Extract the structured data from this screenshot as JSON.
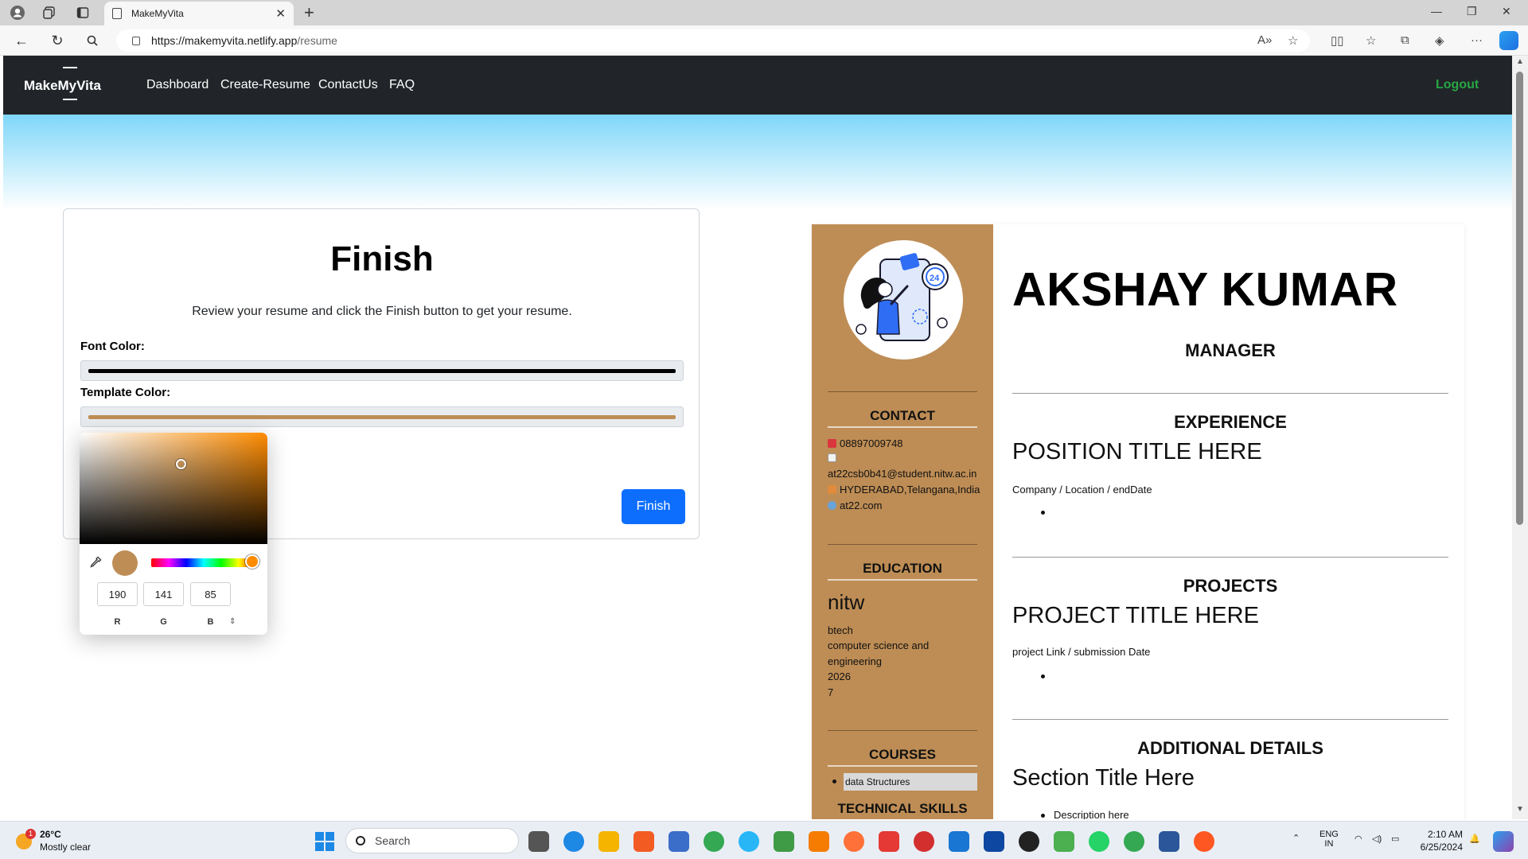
{
  "browser": {
    "tab_title": "MakeMyVita",
    "url_host": "https://makemyvita.netlify.app",
    "url_path": "/resume",
    "new_tab_icon": "plus-icon",
    "close_tab_icon": "close-icon"
  },
  "navbar": {
    "brand": "MakeMyVita",
    "links": [
      "Dashboard",
      "Create-Resume",
      "ContactUs",
      "FAQ"
    ],
    "logout": "Logout"
  },
  "finish_card": {
    "title": "Finish",
    "subtitle": "Review your resume and click the Finish button to get your resume.",
    "font_color_label": "Font Color:",
    "font_color_value": "#000000",
    "template_color_label": "Template Color:",
    "template_color_value": "#be8d55",
    "finish_button": "Finish"
  },
  "color_picker": {
    "r": "190",
    "g": "141",
    "b": "85",
    "r_label": "R",
    "g_label": "G",
    "b_label": "B",
    "mode_toggle": "⇕",
    "preview_color": "#be8d55",
    "hue_color": "#ff8c00"
  },
  "resume": {
    "name": "AKSHAY KUMAR",
    "title": "MANAGER",
    "contact": {
      "heading": "CONTACT",
      "phone": "08897009748",
      "email": "at22csb0b41@student.nitw.ac.in",
      "address": "HYDERABAD,Telangana,India",
      "website": "at22.com"
    },
    "education": {
      "heading": "EDUCATION",
      "institute": "nitw",
      "degree": "btech",
      "branch_line1": "computer science and",
      "branch_line2": "engineering",
      "year": "2026",
      "grade": "7"
    },
    "courses": {
      "heading": "COURSES",
      "items": [
        "data Structures"
      ]
    },
    "technical_skills_heading": "TECHNICAL SKILLS",
    "experience": {
      "heading": "EXPERIENCE",
      "position": "POSITION TITLE HERE",
      "meta": "Company / Location / endDate"
    },
    "projects": {
      "heading": "PROJECTS",
      "title": "PROJECT TITLE HERE",
      "meta": "project Link / submission Date"
    },
    "additional": {
      "heading": "ADDITIONAL DETAILS",
      "section_title": "Section Title Here",
      "description": "Description here"
    },
    "sidebar_color": "#be8d55"
  },
  "taskbar": {
    "weather_temp": "26°C",
    "weather_desc": "Mostly clear",
    "weather_badge": "1",
    "search_placeholder": "Search",
    "lang_top": "ENG",
    "lang_bottom": "IN",
    "time": "2:10 AM",
    "date": "6/25/2024"
  }
}
